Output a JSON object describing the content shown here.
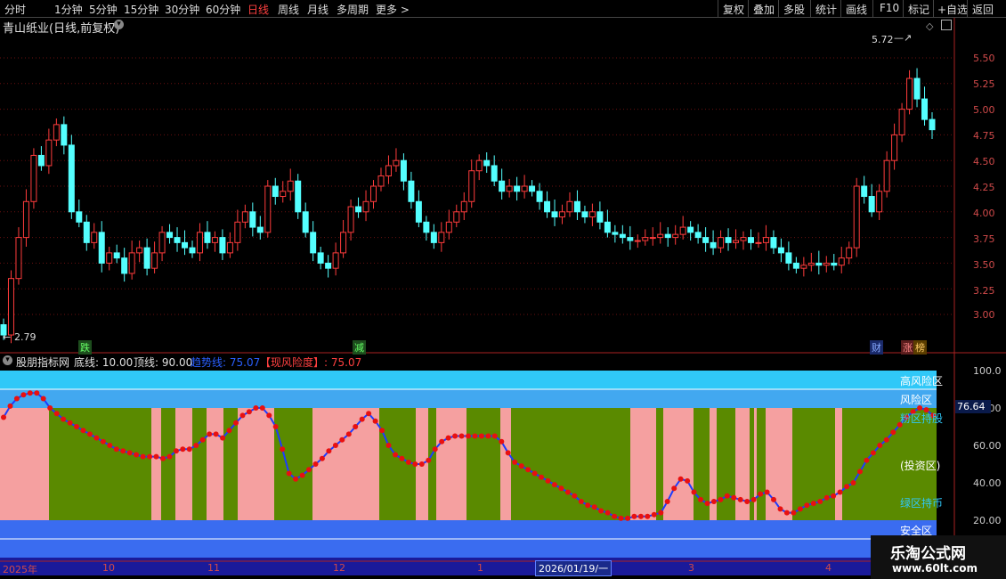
{
  "toolbar": {
    "periods": [
      "分时",
      "1分钟",
      "5分钟",
      "15分钟",
      "30分钟",
      "60分钟",
      "日线",
      "周线",
      "月线",
      "多周期",
      "更多 >"
    ],
    "selected": "日线",
    "actions": [
      "复权",
      "叠加",
      "多股",
      "统计",
      "画线",
      "F10",
      "标记",
      "+自选",
      "返回"
    ]
  },
  "stock": {
    "title": "青山纸业(日线,前复权)"
  },
  "price_axis": [
    "5.50",
    "5.25",
    "5.00",
    "4.75",
    "4.50",
    "4.25",
    "4.00",
    "3.75",
    "3.50",
    "3.25",
    "3.00"
  ],
  "price_high": "5.72",
  "price_low": "2.79",
  "markers": {
    "m1": "跌",
    "m2": "减",
    "m3": "财",
    "m4": "涨",
    "m5": "榜"
  },
  "indicator": {
    "name": "股朋指标网",
    "bottom_line_label": "底线: 10.00",
    "top_line_label": "顶线: 90.00",
    "trend_label": "趋势线: 75.07",
    "risk_label": "【现风险度】: 75.07",
    "zones": [
      "高风险区",
      "风险区",
      "粉区持股",
      "(投资区)",
      "绿区持币",
      "安全区"
    ],
    "axis": [
      "100.0",
      "80.00",
      "60.00",
      "40.00",
      "20.00"
    ],
    "current_value": "76.64"
  },
  "time_axis": {
    "labels": [
      "2025年",
      "10",
      "11",
      "12",
      "1",
      "3",
      "4"
    ],
    "cursor": "2026/01/19/一"
  },
  "watermark": {
    "title": "乐淘公式网",
    "url": "www.60lt.com"
  },
  "colors": {
    "up": "#ff3c3c",
    "down": "#54ffff",
    "pink": "#f5a0a0",
    "green": "#5a8a00",
    "sky": "#30c8f8",
    "blue": "#3a6cf0"
  },
  "chart_data": [
    {
      "type": "candlestick",
      "title": "青山纸业(日线,前复权)",
      "ylim": [
        2.79,
        5.72
      ],
      "x_start": "2025-09",
      "close": [
        2.8,
        3.35,
        3.75,
        4.1,
        4.55,
        4.45,
        4.7,
        4.85,
        4.65,
        4.0,
        3.9,
        3.7,
        3.8,
        3.5,
        3.6,
        3.55,
        3.4,
        3.6,
        3.65,
        3.45,
        3.6,
        3.8,
        3.75,
        3.7,
        3.65,
        3.6,
        3.8,
        3.7,
        3.75,
        3.6,
        3.7,
        3.9,
        4.0,
        3.85,
        3.8,
        4.25,
        4.15,
        4.2,
        4.3,
        4.0,
        3.8,
        3.6,
        3.5,
        3.45,
        3.6,
        3.8,
        4.05,
        4.0,
        4.1,
        4.25,
        4.35,
        4.45,
        4.5,
        4.3,
        4.1,
        3.9,
        3.8,
        3.7,
        3.8,
        3.9,
        4.0,
        4.1,
        4.4,
        4.5,
        4.45,
        4.3,
        4.2,
        4.25,
        4.2,
        4.25,
        4.2,
        4.1,
        4.0,
        3.95,
        4.0,
        4.1,
        4.0,
        3.95,
        4.0,
        3.9,
        3.8,
        3.78,
        3.75,
        3.72,
        3.72,
        3.75,
        3.75,
        3.78,
        3.75,
        3.78,
        3.85,
        3.8,
        3.75,
        3.7,
        3.65,
        3.75,
        3.7,
        3.72,
        3.75,
        3.7,
        3.7,
        3.75,
        3.65,
        3.6,
        3.5,
        3.45,
        3.48,
        3.5,
        3.48,
        3.5,
        3.48,
        3.55,
        3.65,
        4.25,
        4.15,
        4.0,
        4.2,
        4.5,
        4.75,
        5.0,
        5.3,
        5.1,
        4.9,
        4.8
      ]
    },
    {
      "type": "line",
      "title": "股朋指标网",
      "ylim": [
        0,
        100
      ],
      "series": [
        {
          "name": "趋势线",
          "values": [
            75,
            81,
            85,
            87,
            88,
            88,
            85,
            80,
            77,
            74,
            72,
            70,
            68,
            66,
            64,
            62,
            60,
            58,
            57,
            56,
            55,
            54,
            54,
            54,
            53,
            54,
            57,
            58,
            58,
            60,
            63,
            66,
            66,
            64,
            68,
            72,
            76,
            78,
            80,
            80,
            76,
            70,
            58,
            45,
            42,
            44,
            47,
            50,
            53,
            57,
            60,
            63,
            66,
            70,
            74,
            77,
            73,
            68,
            60,
            55,
            53,
            51,
            50,
            50,
            52,
            58,
            62,
            64,
            65,
            65,
            65,
            65,
            65,
            65,
            65,
            62,
            56,
            51,
            49,
            47,
            45,
            43,
            41,
            39,
            37,
            35,
            33,
            30,
            28,
            27,
            25,
            24,
            22,
            21,
            21,
            22,
            22,
            22,
            23,
            24,
            30,
            37,
            42,
            41,
            35,
            31,
            29,
            30,
            31,
            33,
            32,
            31,
            30,
            31,
            34,
            35,
            31,
            26,
            24,
            24,
            26,
            28,
            29,
            30,
            32,
            33,
            35,
            38,
            40,
            46,
            52,
            56,
            60,
            63,
            67,
            71,
            75,
            78,
            80,
            79,
            76
          ]
        }
      ]
    }
  ]
}
